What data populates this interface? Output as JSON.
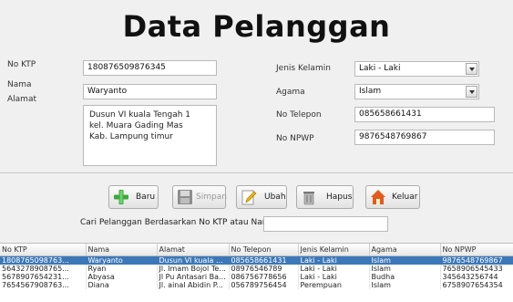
{
  "title": "Data Pelanggan",
  "form": {
    "no_ktp_label": "No KTP",
    "no_ktp_value": "180876509876345",
    "nama_label": "Nama",
    "nama_value": "Waryanto",
    "alamat_label": "Alamat",
    "alamat_lines": [
      "Dusun VI kuala Tengah 1",
      "kel. Muara Gading Mas",
      "Kab. Lampung timur"
    ],
    "jenis_kelamin_label": "Jenis Kelamin",
    "jenis_kelamin_value": "Laki - Laki",
    "agama_label": "Agama",
    "agama_value": "Islam",
    "no_telepon_label": "No Telepon",
    "no_telepon_value": "085658661431",
    "no_npwp_label": "No NPWP",
    "no_npwp_value": "9876548769867"
  },
  "buttons": {
    "baru": "Baru",
    "simpan": "Simpan",
    "ubah": "Ubah",
    "hapus": "Hapus",
    "keluar": "Keluar"
  },
  "search": {
    "label": "Cari Pelanggan Berdasarkan No KTP atau Nama",
    "value": ""
  },
  "table": {
    "columns": [
      "No KTP",
      "Nama",
      "Alamat",
      "No Telepon",
      "Jenis Kelamin",
      "Agama",
      "No NPWP"
    ],
    "rows": [
      [
        "1808765098763...",
        "Waryanto",
        "Dusun VI kuala T...",
        "085658661431",
        "Laki - Laki",
        "Islam",
        "9876548769867"
      ],
      [
        "5643278908765...",
        "Ryan",
        "Jl. Imam Bojol Te...",
        "08976546789",
        "Laki - Laki",
        "Islam",
        "7658906545433"
      ],
      [
        "5678907654231...",
        "Abyasa",
        "Jl Pu Antasari Ba...",
        "086756778656",
        "Laki - Laki",
        "Budha",
        "345643256744"
      ],
      [
        "7654567908763...",
        "Diana",
        "Jl. ainal Abidin P...",
        "056789756454",
        "Perempuan",
        "Islam",
        "6758907654354"
      ]
    ],
    "selected_row": 0
  },
  "colors": {
    "selection": "#3c78b8",
    "background": "#f0f0f0"
  },
  "icons": {
    "baru": "green-plus-icon",
    "simpan": "floppy-disk-icon",
    "ubah": "edit-pencil-icon",
    "hapus": "trash-bin-icon",
    "keluar": "home-exit-icon"
  }
}
